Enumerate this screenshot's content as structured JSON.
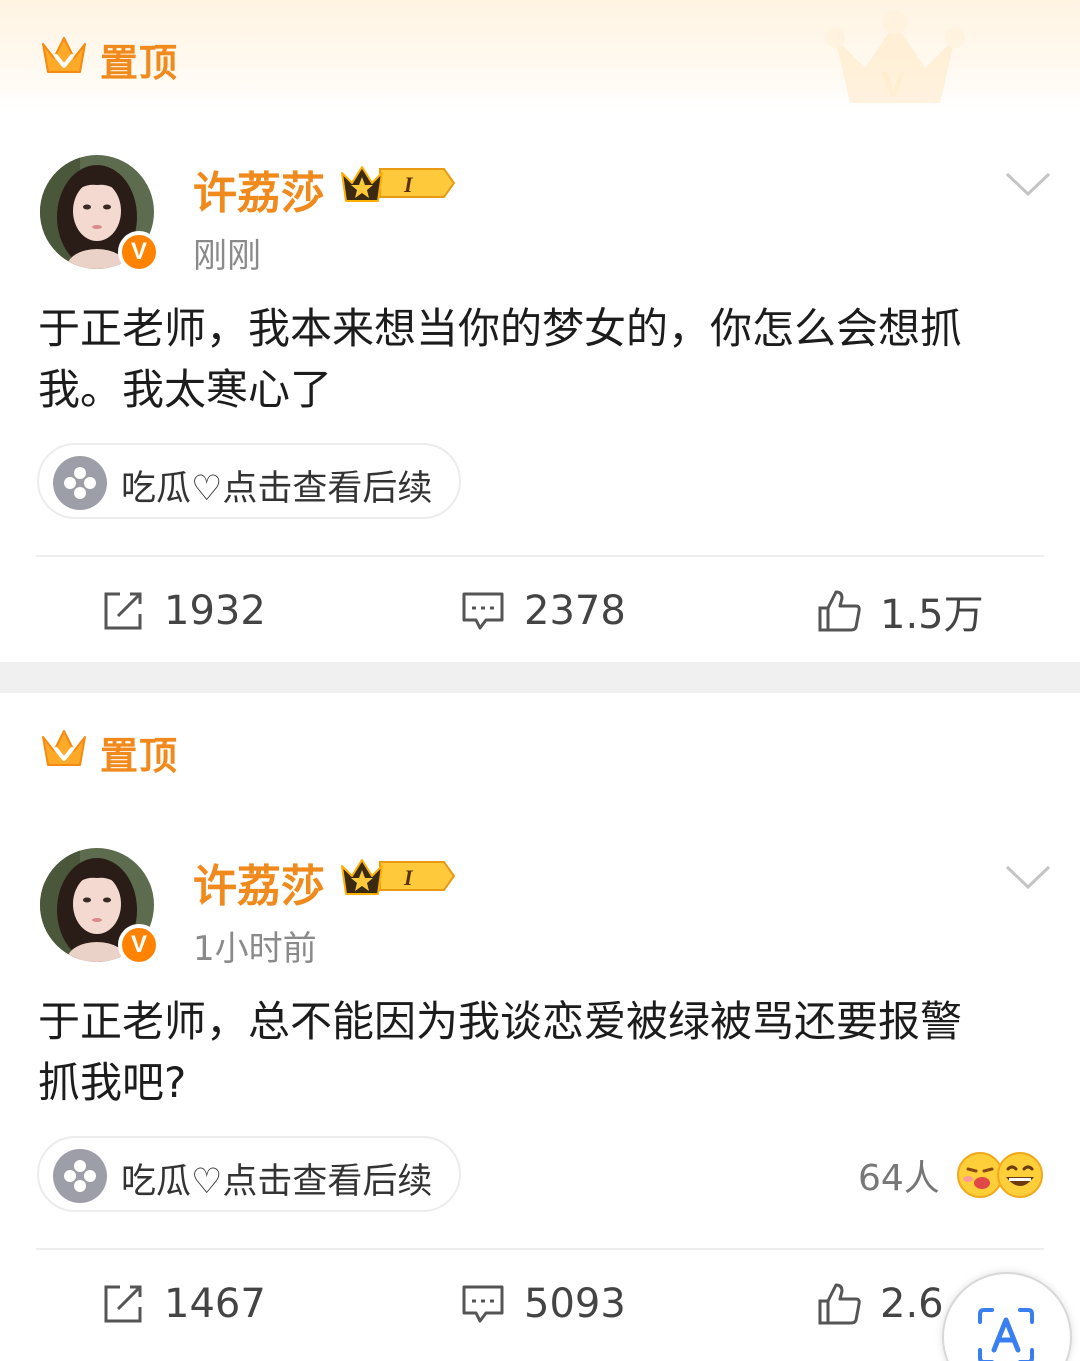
{
  "posts": [
    {
      "pin_label": "置顶",
      "username": "许荔莎",
      "vip_level": "I",
      "timestamp": "刚刚",
      "content_line1": "于正老师，我本来想当你的梦女的，你怎么会想抓",
      "content_line2": "我。我太寒心了",
      "chip_text": "吃瓜♡点击查看后续",
      "reposts": "1932",
      "comments": "2378",
      "likes": "1.5万"
    },
    {
      "pin_label": "置顶",
      "username": "许荔莎",
      "vip_level": "I",
      "timestamp": "1小时前",
      "content_line1": "于正老师，总不能因为我谈恋爱被绿被骂还要报警",
      "content_line2": "抓我吧?",
      "chip_text": "吃瓜♡点击查看后续",
      "reaction_count": "64人",
      "reposts": "1467",
      "comments": "5093",
      "likes": "2.6"
    }
  ],
  "colors": {
    "accent_orange": "#f08a1c",
    "verified_badge": "#ff8200",
    "text": "#1c1c1c",
    "muted": "#8a8a8a"
  },
  "icons": [
    "crown-icon",
    "verified-v-icon",
    "vip-crown-badge-icon",
    "chevron-down-icon",
    "melon-icon",
    "repost-icon",
    "comment-icon",
    "like-icon",
    "emoji-reaction-icon",
    "text-recognition-icon"
  ]
}
